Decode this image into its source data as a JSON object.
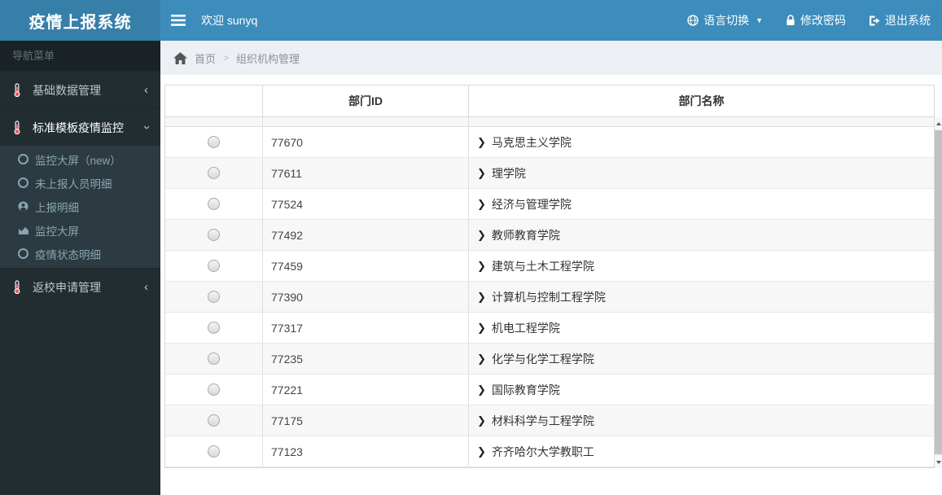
{
  "app": {
    "title": "疫情上报系统"
  },
  "navbar": {
    "welcome": "欢迎 sunyq",
    "menu": [
      {
        "label": "语言切换",
        "icon": "language-icon",
        "caret": "▼"
      },
      {
        "label": "修改密码",
        "icon": "lock-icon"
      },
      {
        "label": "退出系统",
        "icon": "sign-out-icon"
      }
    ]
  },
  "sidebar": {
    "header": "导航菜单",
    "items": [
      {
        "label": "基础数据管理",
        "icon": "thermometer-icon",
        "state": "collapsed",
        "chevron": "‹"
      },
      {
        "label": "标准模板疫情监控",
        "icon": "thermometer-icon",
        "state": "expanded",
        "chevron": "‹",
        "children": [
          {
            "label": "监控大屏（new）",
            "icon": "circle-o-icon"
          },
          {
            "label": "未上报人员明细",
            "icon": "circle-o-icon"
          },
          {
            "label": "上报明细",
            "icon": "user-icon"
          },
          {
            "label": "监控大屏",
            "icon": "area-chart-icon"
          },
          {
            "label": "疫情状态明细",
            "icon": "circle-o-icon"
          }
        ]
      },
      {
        "label": "返校申请管理",
        "icon": "thermometer-icon",
        "state": "collapsed",
        "chevron": "‹"
      }
    ]
  },
  "breadcrumb": {
    "home": "首页",
    "separator": ">",
    "current": "组织机构管理"
  },
  "table": {
    "chevron": "❯",
    "columns": [
      "",
      "部门ID",
      "部门名称"
    ],
    "rows": [
      {
        "id": "77670",
        "name": "马克思主义学院"
      },
      {
        "id": "77611",
        "name": "理学院"
      },
      {
        "id": "77524",
        "name": "经济与管理学院"
      },
      {
        "id": "77492",
        "name": "教师教育学院"
      },
      {
        "id": "77459",
        "name": "建筑与土木工程学院"
      },
      {
        "id": "77390",
        "name": "计算机与控制工程学院"
      },
      {
        "id": "77317",
        "name": "机电工程学院"
      },
      {
        "id": "77235",
        "name": "化学与化学工程学院"
      },
      {
        "id": "77221",
        "name": "国际教育学院"
      },
      {
        "id": "77175",
        "name": "材料科学与工程学院"
      },
      {
        "id": "77123",
        "name": "齐齐哈尔大学教职工"
      }
    ]
  },
  "colors": {
    "navbar": "#3c8dbc",
    "logo_bg": "#367fa9",
    "sidebar_bg": "#222d32",
    "sidebar_header_bg": "#1a2226",
    "submenu_bg": "#2c3b41",
    "breadcrumb_bg": "#ecf0f5",
    "thermometer_red": "#e8596a"
  }
}
